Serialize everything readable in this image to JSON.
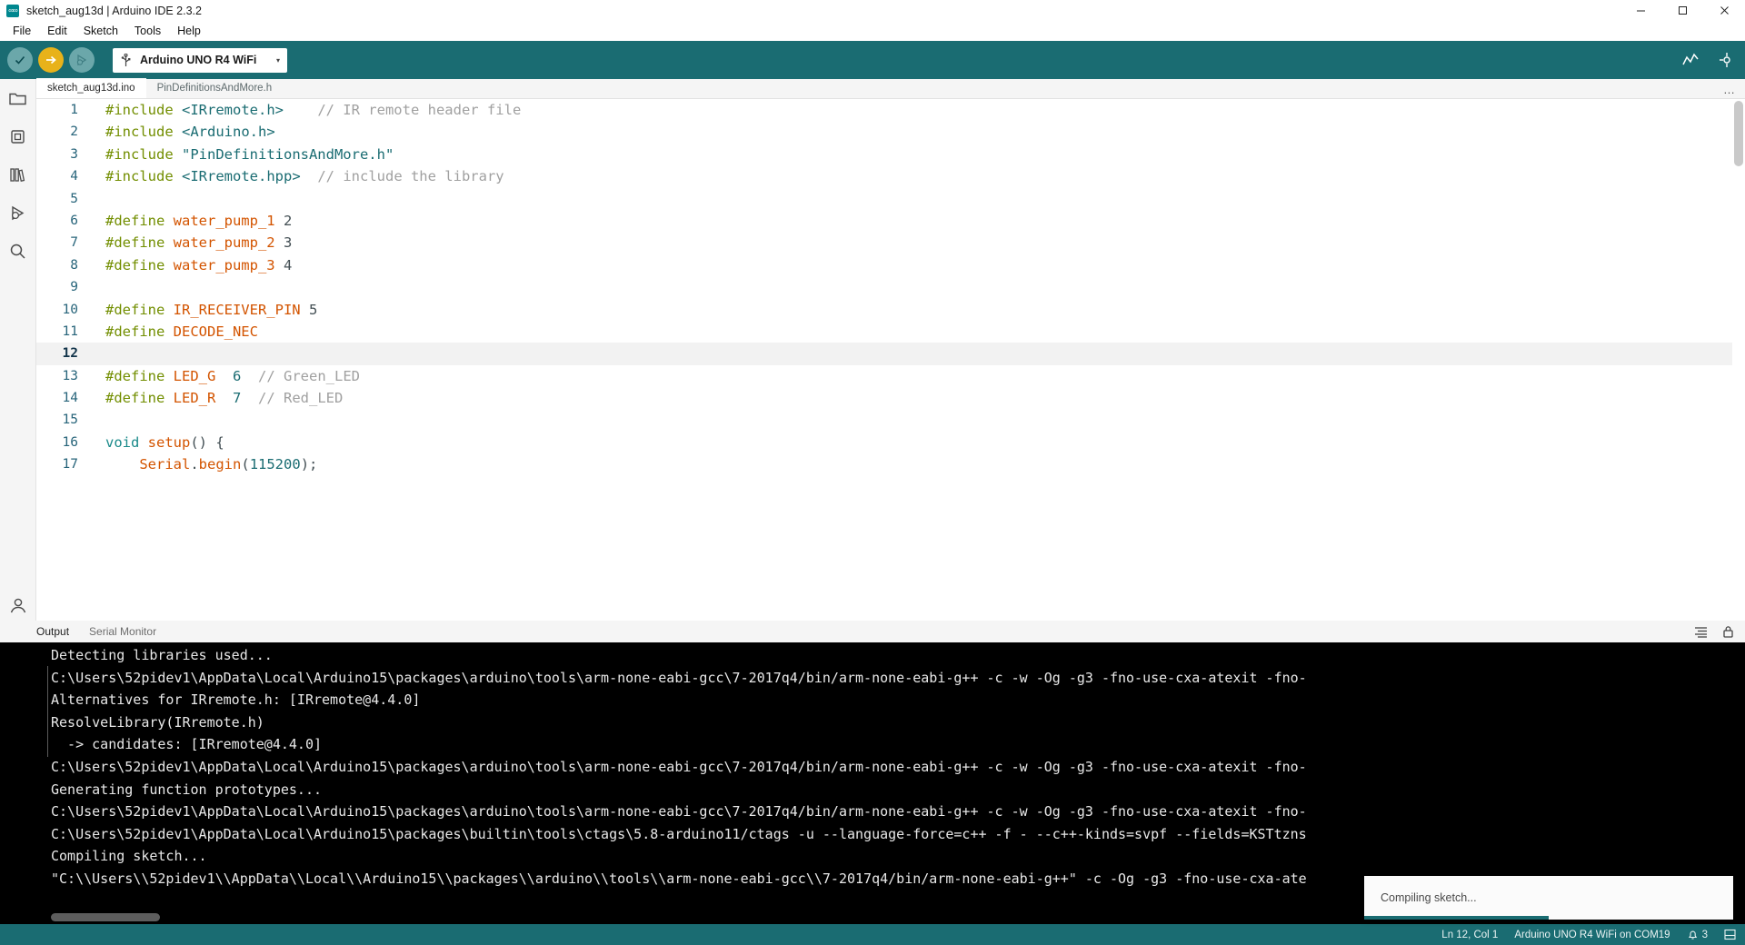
{
  "window": {
    "title": "sketch_aug13d | Arduino IDE 2.3.2",
    "app_icon": "arduino-infinity-icon",
    "minimize_label": "─",
    "maximize_label": "❐",
    "close_label": "✕"
  },
  "menu": {
    "items": [
      {
        "label": "File"
      },
      {
        "label": "Edit"
      },
      {
        "label": "Sketch"
      },
      {
        "label": "Tools"
      },
      {
        "label": "Help"
      }
    ]
  },
  "toolbar": {
    "verify_label": "Verify",
    "upload_label": "Upload",
    "debug_label": "Debug",
    "board_selector": {
      "value": "Arduino UNO R4 WiFi",
      "icon": "usb-icon",
      "caret": "▾"
    },
    "serial_plotter_label": "Serial Plotter",
    "serial_monitor_label": "Serial Monitor"
  },
  "activity_bar": {
    "items": [
      {
        "name": "sketchbook-icon",
        "label": "Sketchbook"
      },
      {
        "name": "boards-manager-icon",
        "label": "Boards Manager"
      },
      {
        "name": "library-manager-icon",
        "label": "Library Manager"
      },
      {
        "name": "debug-icon",
        "label": "Debug"
      },
      {
        "name": "search-icon",
        "label": "Search"
      }
    ],
    "account_label": "Account"
  },
  "editor": {
    "tabs": [
      {
        "label": "sketch_aug13d.ino",
        "active": true
      },
      {
        "label": "PinDefinitionsAndMore.h",
        "active": false
      }
    ],
    "more_label": "…",
    "current_line": 12,
    "lines": [
      {
        "n": "1",
        "tokens": [
          {
            "t": "#include ",
            "c": "t-pre"
          },
          {
            "t": "<IRremote.h>",
            "c": "t-str"
          },
          {
            "t": "    ",
            "c": "t-plain"
          },
          {
            "t": "// IR remote header file",
            "c": "t-com"
          }
        ]
      },
      {
        "n": "2",
        "tokens": [
          {
            "t": "#include ",
            "c": "t-pre"
          },
          {
            "t": "<Arduino.h>",
            "c": "t-str"
          }
        ]
      },
      {
        "n": "3",
        "tokens": [
          {
            "t": "#include ",
            "c": "t-pre"
          },
          {
            "t": "\"PinDefinitionsAndMore.h\"",
            "c": "t-str"
          }
        ]
      },
      {
        "n": "4",
        "tokens": [
          {
            "t": "#include ",
            "c": "t-pre"
          },
          {
            "t": "<IRremote.hpp>",
            "c": "t-str"
          },
          {
            "t": "  ",
            "c": "t-plain"
          },
          {
            "t": "// include the library",
            "c": "t-com"
          }
        ]
      },
      {
        "n": "5",
        "tokens": []
      },
      {
        "n": "6",
        "tokens": [
          {
            "t": "#define ",
            "c": "t-pre"
          },
          {
            "t": "water_pump_1",
            "c": "t-def"
          },
          {
            "t": " 2",
            "c": "t-plain"
          }
        ]
      },
      {
        "n": "7",
        "tokens": [
          {
            "t": "#define ",
            "c": "t-pre"
          },
          {
            "t": "water_pump_2",
            "c": "t-def"
          },
          {
            "t": " 3",
            "c": "t-plain"
          }
        ]
      },
      {
        "n": "8",
        "tokens": [
          {
            "t": "#define ",
            "c": "t-pre"
          },
          {
            "t": "water_pump_3",
            "c": "t-def"
          },
          {
            "t": " 4",
            "c": "t-plain"
          }
        ]
      },
      {
        "n": "9",
        "tokens": []
      },
      {
        "n": "10",
        "tokens": [
          {
            "t": "#define ",
            "c": "t-pre"
          },
          {
            "t": "IR_RECEIVER_PIN",
            "c": "t-def"
          },
          {
            "t": " 5",
            "c": "t-plain"
          }
        ]
      },
      {
        "n": "11",
        "tokens": [
          {
            "t": "#define ",
            "c": "t-pre"
          },
          {
            "t": "DECODE_NEC",
            "c": "t-def"
          }
        ]
      },
      {
        "n": "12",
        "tokens": []
      },
      {
        "n": "13",
        "tokens": [
          {
            "t": "#define ",
            "c": "t-pre"
          },
          {
            "t": "LED_G",
            "c": "t-def"
          },
          {
            "t": "  ",
            "c": "t-plain"
          },
          {
            "t": "6",
            "c": "t-num"
          },
          {
            "t": "  ",
            "c": "t-plain"
          },
          {
            "t": "// Green_LED",
            "c": "t-com"
          }
        ]
      },
      {
        "n": "14",
        "tokens": [
          {
            "t": "#define ",
            "c": "t-pre"
          },
          {
            "t": "LED_R",
            "c": "t-def"
          },
          {
            "t": "  ",
            "c": "t-plain"
          },
          {
            "t": "7",
            "c": "t-num"
          },
          {
            "t": "  ",
            "c": "t-plain"
          },
          {
            "t": "// Red_LED",
            "c": "t-com"
          }
        ]
      },
      {
        "n": "15",
        "tokens": []
      },
      {
        "n": "16",
        "tokens": [
          {
            "t": "void ",
            "c": "t-kw"
          },
          {
            "t": "setup",
            "c": "t-fn"
          },
          {
            "t": "() {",
            "c": "t-plain"
          }
        ]
      },
      {
        "n": "17",
        "tokens": [
          {
            "t": "    ",
            "c": "t-plain"
          },
          {
            "t": "Serial",
            "c": "t-fn"
          },
          {
            "t": ".",
            "c": "t-plain"
          },
          {
            "t": "begin",
            "c": "t-fn"
          },
          {
            "t": "(",
            "c": "t-plain"
          },
          {
            "t": "115200",
            "c": "t-num"
          },
          {
            "t": ");",
            "c": "t-plain"
          }
        ]
      }
    ]
  },
  "panel": {
    "tabs": [
      {
        "label": "Output",
        "active": true
      },
      {
        "label": "Serial Monitor",
        "active": false
      }
    ],
    "tools": [
      {
        "name": "clear-output-icon"
      },
      {
        "name": "lock-scroll-icon"
      }
    ],
    "console_lines": [
      "Detecting libraries used...",
      "C:\\Users\\52pidev1\\AppData\\Local\\Arduino15\\packages\\arduino\\tools\\arm-none-eabi-gcc\\7-2017q4/bin/arm-none-eabi-g++ -c -w -Og -g3 -fno-use-cxa-atexit -fno-",
      "Alternatives for IRremote.h: [IRremote@4.4.0]",
      "ResolveLibrary(IRremote.h)",
      "  -> candidates: [IRremote@4.4.0]",
      "C:\\Users\\52pidev1\\AppData\\Local\\Arduino15\\packages\\arduino\\tools\\arm-none-eabi-gcc\\7-2017q4/bin/arm-none-eabi-g++ -c -w -Og -g3 -fno-use-cxa-atexit -fno-",
      "Generating function prototypes...",
      "C:\\Users\\52pidev1\\AppData\\Local\\Arduino15\\packages\\arduino\\tools\\arm-none-eabi-gcc\\7-2017q4/bin/arm-none-eabi-g++ -c -w -Og -g3 -fno-use-cxa-atexit -fno-",
      "C:\\Users\\52pidev1\\AppData\\Local\\Arduino15\\packages\\builtin\\tools\\ctags\\5.8-arduino11/ctags -u --language-force=c++ -f - --c++-kinds=svpf --fields=KSTtzns",
      "Compiling sketch...",
      "\"C:\\\\Users\\\\52pidev1\\\\AppData\\\\Local\\\\Arduino15\\\\packages\\\\arduino\\\\tools\\\\arm-none-eabi-gcc\\\\7-2017q4/bin/arm-none-eabi-g++\" -c -Og -g3 -fno-use-cxa-ate"
    ]
  },
  "toast": {
    "message": "Compiling sketch...",
    "progress_percent": 50
  },
  "status_bar": {
    "cursor_position": "Ln 12, Col 1",
    "board_port": "Arduino UNO R4 WiFi on COM19",
    "notifications_count": "3",
    "notifications_icon": "bell-icon",
    "panel_toggle_icon": "panel-layout-icon"
  },
  "colors": {
    "accent_teal": "#1a6c72",
    "upload_yellow": "#e8b21a",
    "console_bg": "#000000",
    "editor_bg": "#ffffff"
  }
}
